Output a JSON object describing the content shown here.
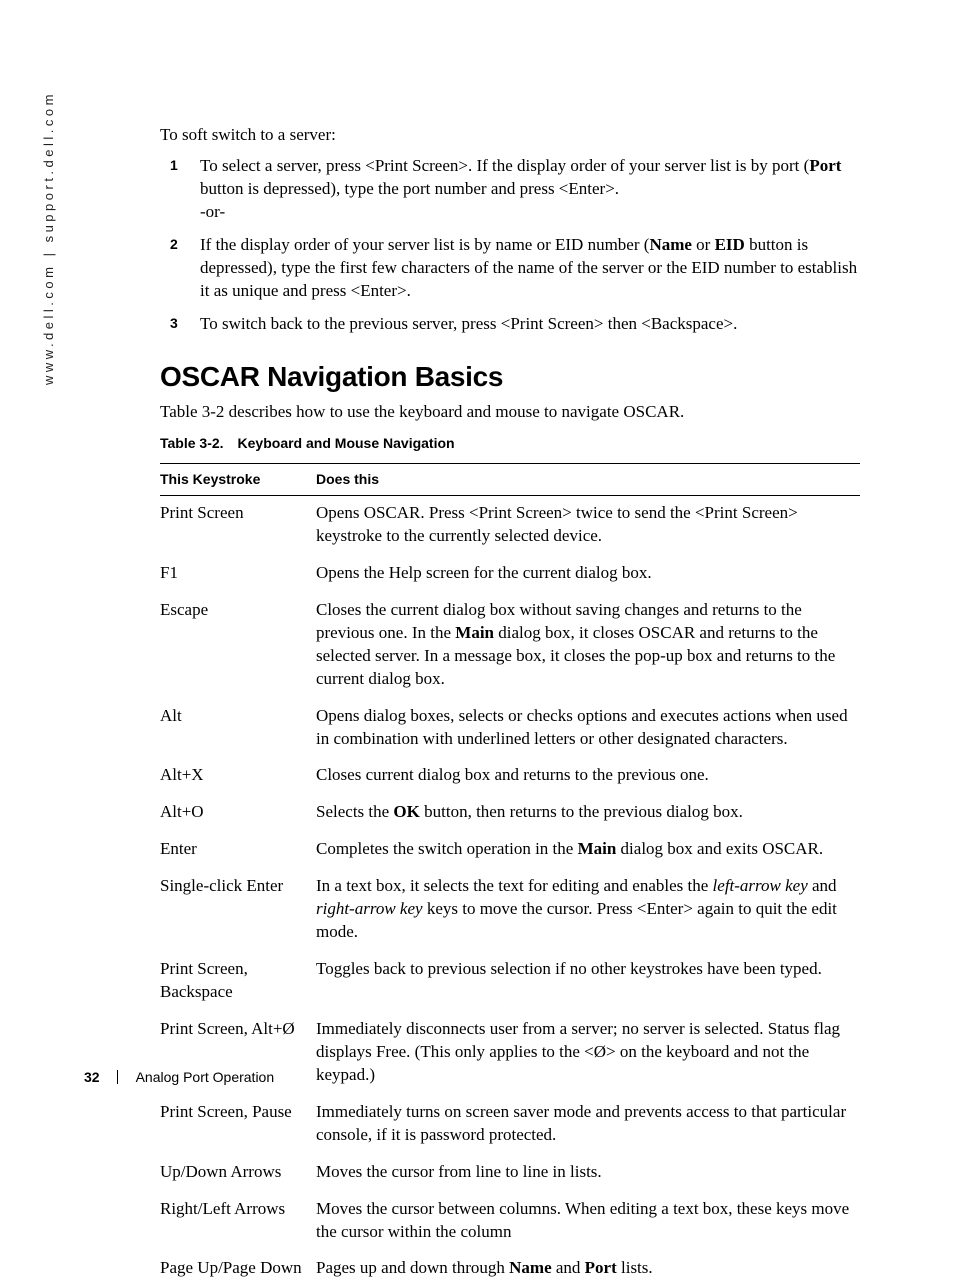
{
  "sidebar": "www.dell.com | support.dell.com",
  "intro": "To soft switch to a server:",
  "steps": [
    {
      "num": "1",
      "parts": [
        {
          "t": "plain",
          "v": "To select a server, press <Print Screen>. If the display order of your server list is by port ("
        },
        {
          "t": "bold",
          "v": "Port"
        },
        {
          "t": "plain",
          "v": " button is depressed), type the port number and press <Enter>."
        },
        {
          "t": "br"
        },
        {
          "t": "plain",
          "v": "-or-"
        }
      ]
    },
    {
      "num": "2",
      "parts": [
        {
          "t": "plain",
          "v": "If the display order of your server list is by name or EID number ("
        },
        {
          "t": "bold",
          "v": "Name"
        },
        {
          "t": "plain",
          "v": " or "
        },
        {
          "t": "bold",
          "v": "EID"
        },
        {
          "t": "plain",
          "v": " button is depressed), type the first few characters of the name of the server or the EID number to establish it as unique and press <Enter>."
        }
      ]
    },
    {
      "num": "3",
      "parts": [
        {
          "t": "plain",
          "v": "To switch back to the previous server, press <Print Screen> then <Backspace>."
        }
      ]
    }
  ],
  "section_title": "OSCAR Navigation Basics",
  "table_intro": "Table 3-2 describes how to use the keyboard and mouse to navigate OSCAR.",
  "table_caption": "Table 3-2. Keyboard and Mouse Navigation",
  "table": {
    "head": [
      "This Keystroke",
      "Does this"
    ],
    "rows": [
      {
        "k": "Print Screen",
        "d": [
          {
            "t": "plain",
            "v": "Opens OSCAR. Press <Print Screen> twice to send the <Print Screen> keystroke to the currently selected device."
          }
        ]
      },
      {
        "k": "F1",
        "d": [
          {
            "t": "plain",
            "v": "Opens the Help screen for the current dialog box."
          }
        ]
      },
      {
        "k": "Escape",
        "d": [
          {
            "t": "plain",
            "v": "Closes the current dialog box without saving changes and returns to the previous one. In the "
          },
          {
            "t": "bold",
            "v": "Main"
          },
          {
            "t": "plain",
            "v": " dialog box, it closes OSCAR and returns to the selected server. In a message box, it closes the pop-up box and returns to the current dialog box."
          }
        ]
      },
      {
        "k": "Alt",
        "d": [
          {
            "t": "plain",
            "v": "Opens dialog boxes, selects or checks options and executes actions when used in combination with underlined letters or other designated characters."
          }
        ]
      },
      {
        "k": "Alt+X",
        "d": [
          {
            "t": "plain",
            "v": "Closes current dialog box and returns to the previous one."
          }
        ]
      },
      {
        "k": "Alt+O",
        "d": [
          {
            "t": "plain",
            "v": "Selects the "
          },
          {
            "t": "bold",
            "v": "OK"
          },
          {
            "t": "plain",
            "v": " button, then returns to the previous dialog box."
          }
        ]
      },
      {
        "k": "Enter",
        "d": [
          {
            "t": "plain",
            "v": "Completes the switch operation in the "
          },
          {
            "t": "bold",
            "v": "Main"
          },
          {
            "t": "plain",
            "v": " dialog box and exits OSCAR."
          }
        ]
      },
      {
        "k": "Single-click Enter",
        "d": [
          {
            "t": "plain",
            "v": "In a text box, it selects the text for editing and enables the "
          },
          {
            "t": "italic",
            "v": "left-arrow key"
          },
          {
            "t": "plain",
            "v": " and "
          },
          {
            "t": "italic",
            "v": "right-arrow key"
          },
          {
            "t": "plain",
            "v": " keys to move the cursor. Press <Enter> again to quit the edit mode."
          }
        ]
      },
      {
        "k": "Print Screen, Backspace",
        "d": [
          {
            "t": "plain",
            "v": "Toggles back to previous selection if no other keystrokes have been typed."
          }
        ]
      },
      {
        "k": "Print Screen, Alt+Ø",
        "d": [
          {
            "t": "plain",
            "v": "Immediately disconnects user from a server; no server is selected. Status flag displays Free. (This only applies to the <Ø> on the keyboard and not the keypad.)"
          }
        ]
      },
      {
        "k": "Print Screen, Pause",
        "d": [
          {
            "t": "plain",
            "v": "Immediately turns on screen saver mode and prevents access to that particular console, if it is password protected."
          }
        ]
      },
      {
        "k": "Up/Down Arrows",
        "d": [
          {
            "t": "plain",
            "v": "Moves the cursor from line to line in lists."
          }
        ]
      },
      {
        "k": "Right/Left Arrows",
        "d": [
          {
            "t": "plain",
            "v": "Moves the cursor between columns. When editing a text box, these keys move the cursor within the column"
          }
        ]
      },
      {
        "k": "Page Up/Page Down",
        "d": [
          {
            "t": "plain",
            "v": "Pages up and down through "
          },
          {
            "t": "bold",
            "v": "Name"
          },
          {
            "t": "plain",
            "v": " and "
          },
          {
            "t": "bold",
            "v": "Port"
          },
          {
            "t": "plain",
            "v": " lists."
          }
        ]
      }
    ]
  },
  "footer": {
    "page": "32",
    "title": "Analog Port Operation"
  }
}
